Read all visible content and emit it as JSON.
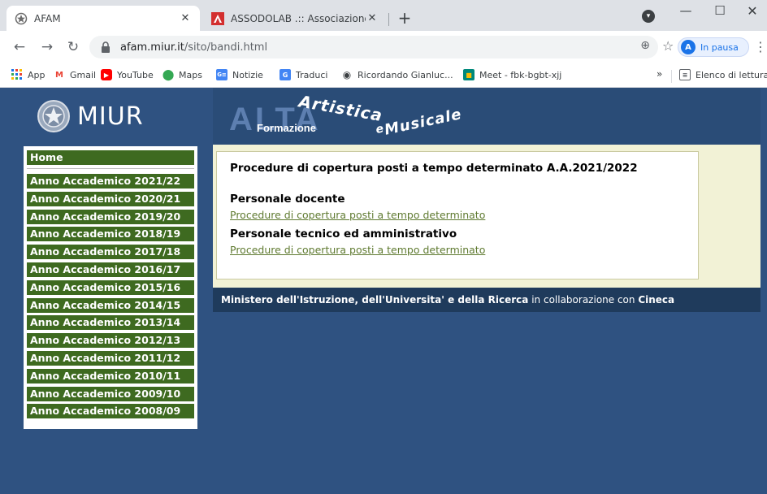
{
  "browser": {
    "tabs": [
      {
        "title": "AFAM",
        "active": true
      },
      {
        "title": "ASSODOLAB .:: Associazione Na:",
        "active": false
      }
    ],
    "new_tab": "+",
    "url_host": "afam.miur.it",
    "url_path": "/sito/bandi.html",
    "profile_initial": "A",
    "profile_label": "In pausa",
    "bookmarks": [
      {
        "label": "App",
        "icon": "apps-grid-icon"
      },
      {
        "label": "Gmail",
        "icon": "gmail-icon"
      },
      {
        "label": "YouTube",
        "icon": "youtube-icon"
      },
      {
        "label": "Maps",
        "icon": "maps-icon"
      },
      {
        "label": "Notizie",
        "icon": "news-icon"
      },
      {
        "label": "Traduci",
        "icon": "translate-icon"
      },
      {
        "label": "Ricordando Gianluc...",
        "icon": "globe-icon"
      },
      {
        "label": "Meet - fbk-bgbt-xjj",
        "icon": "meet-icon"
      }
    ],
    "bookmarks_more": "»",
    "reading_list": "Elenco di lettura"
  },
  "site": {
    "logo_text": "MIUR",
    "banner": {
      "alta": "ALTA",
      "formazione": "Formazione",
      "artistica": "Artistica",
      "e": "e",
      "musicale": "Musicale"
    },
    "menu": {
      "home": "Home",
      "years": [
        "Anno Accademico 2021/22",
        "Anno Accademico 2020/21",
        "Anno Accademico 2019/20",
        "Anno Accademico 2018/19",
        "Anno Accademico 2017/18",
        "Anno Accademico 2016/17",
        "Anno Accademico 2015/16",
        "Anno Accademico 2014/15",
        "Anno Accademico 2013/14",
        "Anno Accademico 2012/13",
        "Anno Accademico 2011/12",
        "Anno Accademico 2010/11",
        "Anno Accademico 2009/10",
        "Anno Accademico 2008/09"
      ]
    },
    "content": {
      "title": "Procedure di copertura posti a tempo determinato A.A.2021/2022",
      "sections": [
        {
          "heading": "Personale docente",
          "link": "Procedure di copertura posti a tempo determinato"
        },
        {
          "heading": "Personale tecnico ed amministrativo",
          "link": "Procedure di copertura posti a tempo determinato"
        }
      ]
    },
    "footer": {
      "ministry": "Ministero dell'Istruzione, dell'Universita' e della Ricerca",
      "middle": " in collaborazione con ",
      "partner": "Cineca"
    }
  },
  "colors": {
    "page_bg": "#2f5281",
    "menu_item": "#3e6a20",
    "content_bg": "#f2f2d6",
    "link": "#5f7a30",
    "footer_bg": "#1f3b5c"
  }
}
